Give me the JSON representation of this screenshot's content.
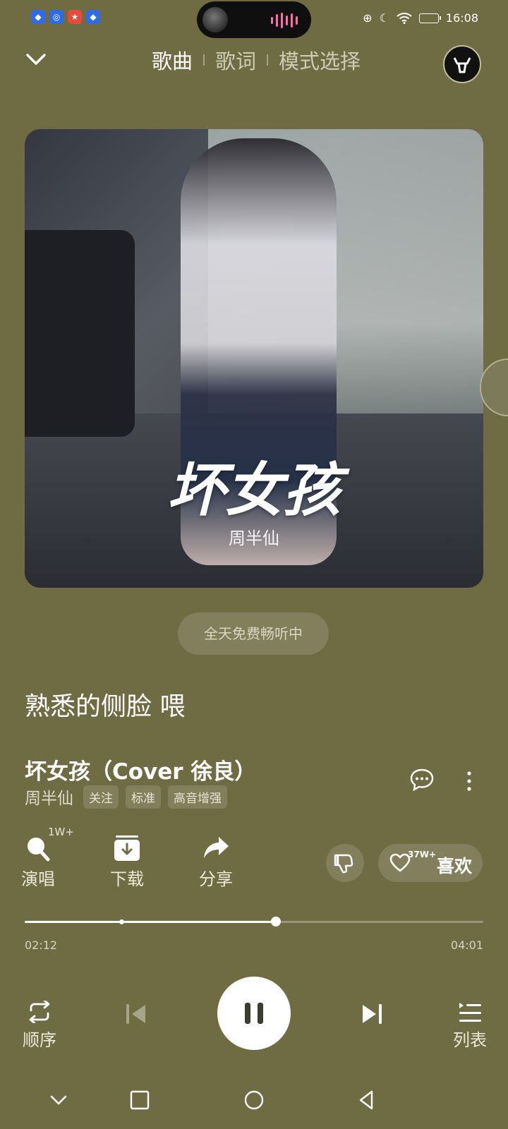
{
  "status_bar": {
    "time": "16:08",
    "badges": [
      "shield-icon",
      "target-icon",
      "emblem-icon",
      "shield-icon"
    ]
  },
  "header": {
    "tabs": [
      {
        "label": "歌曲",
        "active": true
      },
      {
        "label": "歌词",
        "active": false
      },
      {
        "label": "模式选择",
        "active": false
      }
    ]
  },
  "cover": {
    "title": "坏女孩",
    "artist": "周半仙"
  },
  "free_notice": "全天免费畅听中",
  "lyric_line": "熟悉的侧脸 喂",
  "song": {
    "title": "坏女孩（Cover 徐良）",
    "artist": "周半仙",
    "tags": [
      "关注",
      "标准",
      "高音增强"
    ]
  },
  "actions": {
    "sing": {
      "label": "演唱",
      "badge": "1W+"
    },
    "download": {
      "label": "下载"
    },
    "share": {
      "label": "分享"
    },
    "like": {
      "label": "喜欢",
      "count": "37W+"
    }
  },
  "progress": {
    "current": "02:12",
    "total": "04:01",
    "fraction": 0.548,
    "marker_fraction": 0.21
  },
  "controls": {
    "order_label": "顺序",
    "list_label": "列表"
  },
  "colors": {
    "background": "#6f6b43",
    "accent": "#ffffff",
    "island_wave": "#ff6aa7"
  }
}
